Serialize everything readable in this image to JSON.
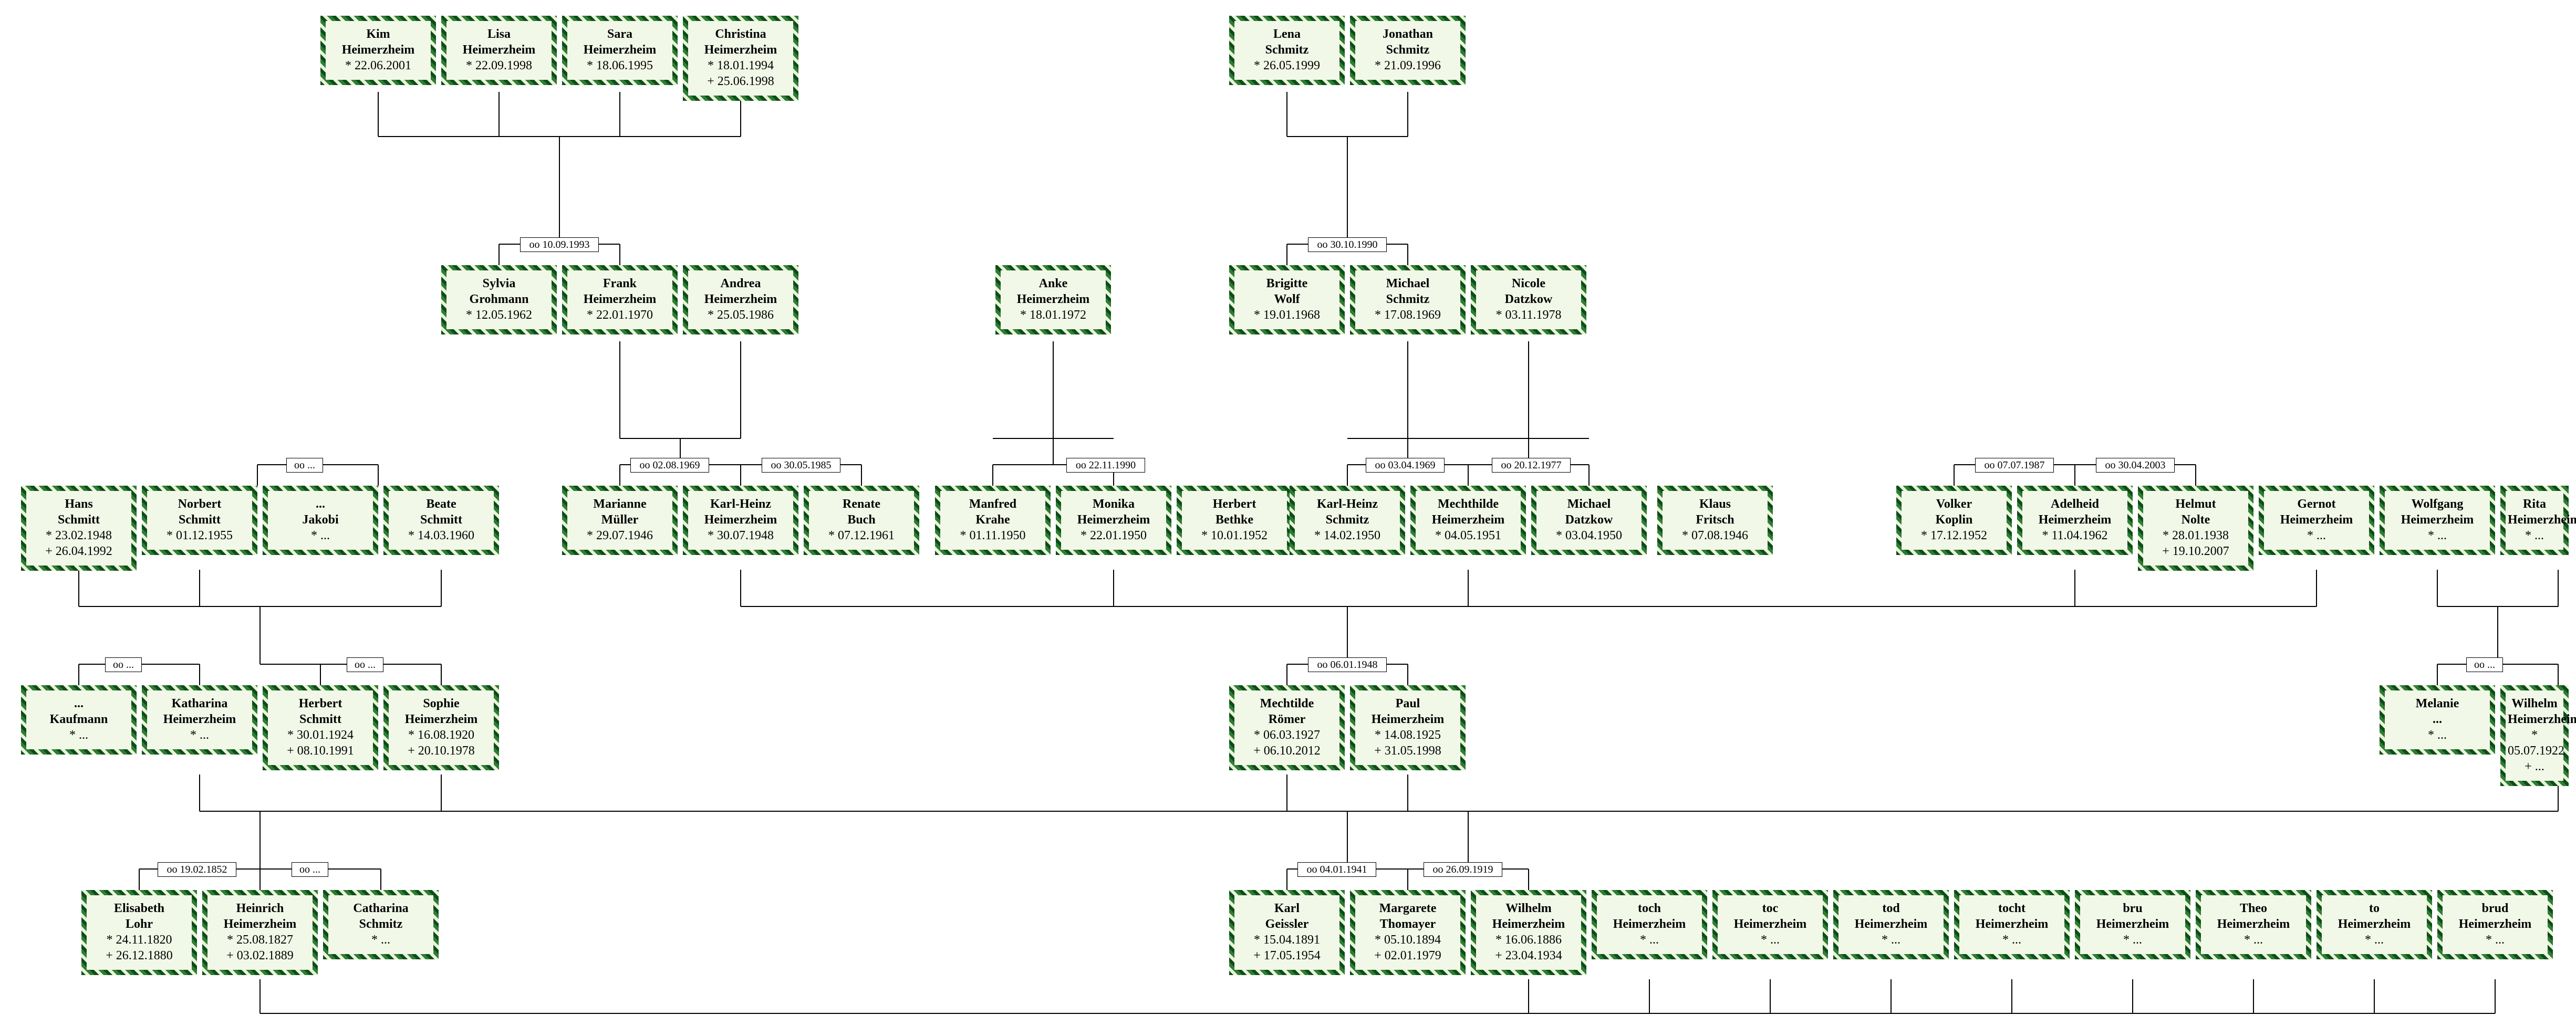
{
  "marriages": {
    "m_sylvia_frank": "oo 10.09.1993",
    "m_brigitte_michael": "oo 30.10.1990",
    "m_norbert_jakobi": "oo ...",
    "m_marianne_kh": "oo 02.08.1969",
    "m_kh_renate": "oo 30.05.1985",
    "m_manfred_monika": "oo 22.11.1990",
    "m_khschmitz_mecht": "oo 03.04.1969",
    "m_mecht_datzkow": "oo 20.12.1977",
    "m_volker_adelheid": "oo 07.07.1987",
    "m_adelheid_helmut": "oo 30.04.2003",
    "m_kaufmann_kath": "oo ...",
    "m_herbert_sophie": "oo ...",
    "m_mecht_paul": "oo 06.01.1948",
    "m_melanie_wilhelm": "oo ...",
    "m_elisabeth_heinrich": "oo 19.02.1852",
    "m_heinrich_cath": "oo ...",
    "m_karl_marg": "oo 04.01.1941",
    "m_marg_wilhelm": "oo 26.09.1919"
  },
  "people": {
    "kim": {
      "first": "Kim",
      "last": "Heimerzheim",
      "born": "* 22.06.2001"
    },
    "lisa": {
      "first": "Lisa",
      "last": "Heimerzheim",
      "born": "* 22.09.1998"
    },
    "sara": {
      "first": "Sara",
      "last": "Heimerzheim",
      "born": "* 18.06.1995"
    },
    "christina": {
      "first": "Christina",
      "last": "Heimerzheim",
      "born": "* 18.01.1994",
      "died": "+ 25.06.1998"
    },
    "lena": {
      "first": "Lena",
      "last": "Schmitz",
      "born": "* 26.05.1999"
    },
    "jonathan": {
      "first": "Jonathan",
      "last": "Schmitz",
      "born": "* 21.09.1996"
    },
    "sylvia": {
      "first": "Sylvia",
      "last": "Grohmann",
      "born": "* 12.05.1962"
    },
    "frank": {
      "first": "Frank",
      "last": "Heimerzheim",
      "born": "* 22.01.1970"
    },
    "andrea": {
      "first": "Andrea",
      "last": "Heimerzheim",
      "born": "* 25.05.1986"
    },
    "anke": {
      "first": "Anke",
      "last": "Heimerzheim",
      "born": "* 18.01.1972"
    },
    "brigitte": {
      "first": "Brigitte",
      "last": "Wolf",
      "born": "* 19.01.1968"
    },
    "michaelS": {
      "first": "Michael",
      "last": "Schmitz",
      "born": "* 17.08.1969"
    },
    "nicole": {
      "first": "Nicole",
      "last": "Datzkow",
      "born": "* 03.11.1978"
    },
    "hans": {
      "first": "Hans",
      "last": "Schmitt",
      "born": "* 23.02.1948",
      "died": "+ 26.04.1992"
    },
    "norbert": {
      "first": "Norbert",
      "last": "Schmitt",
      "born": "* 01.12.1955"
    },
    "jakobi": {
      "first": "...",
      "last": "Jakobi",
      "born": "* ..."
    },
    "beate": {
      "first": "Beate",
      "last": "Schmitt",
      "born": "* 14.03.1960"
    },
    "marianne": {
      "first": "Marianne",
      "last": "Müller",
      "born": "* 29.07.1946"
    },
    "khHeim": {
      "first": "Karl-Heinz",
      "last": "Heimerzheim",
      "born": "* 30.07.1948"
    },
    "renate": {
      "first": "Renate",
      "last": "Buch",
      "born": "* 07.12.1961"
    },
    "manfred": {
      "first": "Manfred",
      "last": "Krahe",
      "born": "* 01.11.1950"
    },
    "monika": {
      "first": "Monika",
      "last": "Heimerzheim",
      "born": "* 22.01.1950"
    },
    "herbertB": {
      "first": "Herbert",
      "last": "Bethke",
      "born": "* 10.01.1952"
    },
    "khSchmitz": {
      "first": "Karl-Heinz",
      "last": "Schmitz",
      "born": "* 14.02.1950"
    },
    "mechtH": {
      "first": "Mechthilde",
      "last": "Heimerzheim",
      "born": "* 04.05.1951"
    },
    "michaelD": {
      "first": "Michael",
      "last": "Datzkow",
      "born": "* 03.04.1950"
    },
    "klaus": {
      "first": "Klaus",
      "last": "Fritsch",
      "born": "* 07.08.1946"
    },
    "volker": {
      "first": "Volker",
      "last": "Koplin",
      "born": "* 17.12.1952"
    },
    "adelheid": {
      "first": "Adelheid",
      "last": "Heimerzheim",
      "born": "* 11.04.1962"
    },
    "helmut": {
      "first": "Helmut",
      "last": "Nolte",
      "born": "* 28.01.1938",
      "died": "+ 19.10.2007"
    },
    "gernot": {
      "first": "Gernot",
      "last": "Heimerzheim",
      "born": "* ..."
    },
    "wolfgang": {
      "first": "Wolfgang",
      "last": "Heimerzheim",
      "born": "* ..."
    },
    "rita": {
      "first": "Rita",
      "last": "Heimerzheim",
      "born": "* ..."
    },
    "kaufmann": {
      "first": "...",
      "last": "Kaufmann",
      "born": "* ..."
    },
    "katharina": {
      "first": "Katharina",
      "last": "Heimerzheim",
      "born": "* ..."
    },
    "herbertS": {
      "first": "Herbert",
      "last": "Schmitt",
      "born": "* 30.01.1924",
      "died": "+ 08.10.1991"
    },
    "sophie": {
      "first": "Sophie",
      "last": "Heimerzheim",
      "born": "* 16.08.1920",
      "died": "+ 20.10.1978"
    },
    "mechtR": {
      "first": "Mechtilde",
      "last": "Römer",
      "born": "* 06.03.1927",
      "died": "+ 06.10.2012"
    },
    "paul": {
      "first": "Paul",
      "last": "Heimerzheim",
      "born": "* 14.08.1925",
      "died": "+ 31.05.1998"
    },
    "melanie": {
      "first": "Melanie",
      "last": "...",
      "born": "* ..."
    },
    "wilhelmH": {
      "first": "Wilhelm",
      "last": "Heimerzheim",
      "born": "* 05.07.1922",
      "died": "+ ..."
    },
    "elisabeth": {
      "first": "Elisabeth",
      "last": "Lohr",
      "born": "* 24.11.1820",
      "died": "+ 26.12.1880"
    },
    "heinrich": {
      "first": "Heinrich",
      "last": "Heimerzheim",
      "born": "* 25.08.1827",
      "died": "+ 03.02.1889"
    },
    "catharina": {
      "first": "Catharina",
      "last": "Schmitz",
      "born": "* ..."
    },
    "karl": {
      "first": "Karl",
      "last": "Geissler",
      "born": "* 15.04.1891",
      "died": "+ 17.05.1954"
    },
    "margarete": {
      "first": "Margarete",
      "last": "Thomayer",
      "born": "* 05.10.1894",
      "died": "+ 02.01.1979"
    },
    "wilhelmH2": {
      "first": "Wilhelm",
      "last": "Heimerzheim",
      "born": "* 16.06.1886",
      "died": "+ 23.04.1934"
    },
    "toch": {
      "first": "toch",
      "last": "Heimerzheim",
      "born": "* ..."
    },
    "toc": {
      "first": "toc",
      "last": "Heimerzheim",
      "born": "* ..."
    },
    "tod": {
      "first": "tod",
      "last": "Heimerzheim",
      "born": "* ..."
    },
    "tocht": {
      "first": "tocht",
      "last": "Heimerzheim",
      "born": "* ..."
    },
    "bru": {
      "first": "bru",
      "last": "Heimerzheim",
      "born": "* ..."
    },
    "theo": {
      "first": "Theo",
      "last": "Heimerzheim",
      "born": "* ..."
    },
    "to": {
      "first": "to",
      "last": "Heimerzheim",
      "born": "* ..."
    },
    "brud": {
      "first": "brud",
      "last": "Heimerzheim",
      "born": "* ..."
    }
  }
}
